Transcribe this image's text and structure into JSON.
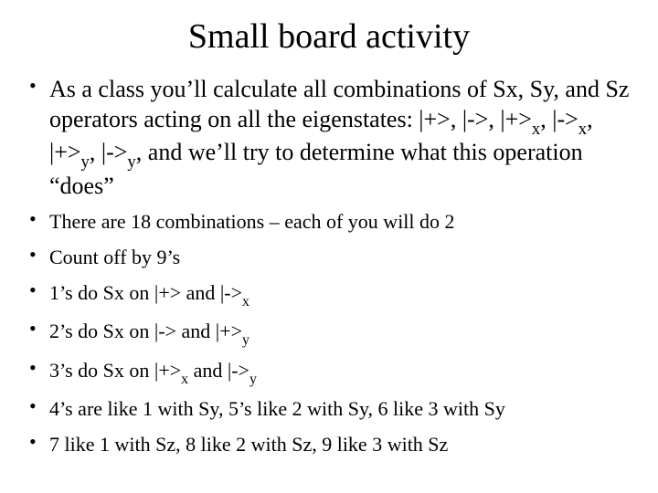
{
  "title": "Small board activity",
  "intro_html": "As a class you’ll calculate all combinations of Sx, Sy, and Sz operators acting on all the eigenstates: |+>, |->, |+><span class=\"sub\">x</span>, |-><span class=\"sub\">x</span>, |+><span class=\"sub\">y</span>, |-><span class=\"sub\">y</span>, and we’ll try to determine what this operation “does”",
  "items_html": [
    "There are 18 combinations – each of you will do 2",
    "Count off by 9’s",
    "1’s do Sx on |+> and |-><span class=\"sub\">x</span>",
    "2’s do Sx on |-> and |+><span class=\"sub\">y</span>",
    "3’s do Sx on |+><span class=\"sub\">x</span> and |-><span class=\"sub\">y</span>",
    "4’s are like 1 with Sy, 5’s like 2 with Sy, 6 like 3 with Sy",
    "7 like 1 with Sz, 8 like 2 with Sz, 9 like 3 with Sz"
  ]
}
